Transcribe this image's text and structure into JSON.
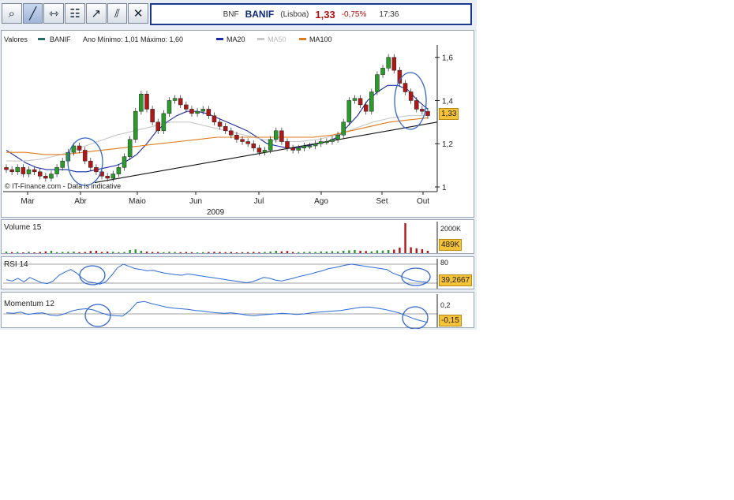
{
  "toolbar": {
    "tools": [
      "zoom-in",
      "draw-line",
      "horizontal-line",
      "indicators",
      "trend-line",
      "parallel-lines",
      "delete"
    ]
  },
  "quote": {
    "symbol": "BNF",
    "name": "BANIF",
    "market": "(Lisboa)",
    "price": "1,33",
    "change": "-0,75%",
    "time": "17:36"
  },
  "legend": {
    "values": "Valores",
    "series": "BANIF",
    "range": "Ano Mínimo: 1,01 Máximo: 1,60",
    "ma20": "MA20",
    "ma50": "MA50",
    "ma100": "MA100"
  },
  "colors": {
    "up": "#2a9a2a",
    "down": "#b01818",
    "ma20": "#1a2aa8",
    "ma50": "#c8c8c8",
    "ma100": "#e07a1a",
    "indicator": "#2a6ad8",
    "circle": "#3366cc",
    "tag": "#f6c23a"
  },
  "watermark": "© IT-Finance.com - Data is indicative",
  "year_label": "2009",
  "current_tag": "1,33",
  "volume": {
    "label": "Volume 15",
    "tick": "2000K",
    "tag": "489K"
  },
  "rsi": {
    "label": "RSI 14",
    "tick": "80",
    "tag": "39,2667"
  },
  "momentum": {
    "label": "Momentum 12",
    "tick": "0,2",
    "tag": "-0,15"
  },
  "chart_data": {
    "type": "candlestick",
    "title": "",
    "ylabel": "",
    "ylim": [
      1.0,
      1.65
    ],
    "y_ticks": [
      "1,6",
      "1,4",
      "1,2",
      "1"
    ],
    "x_ticks": [
      "Mar",
      "Abr",
      "Maio",
      "Jun",
      "Jul",
      "Ago",
      "Set",
      "Out"
    ],
    "series": [
      {
        "name": "BANIF",
        "close": [
          1.08,
          1.07,
          1.09,
          1.06,
          1.08,
          1.07,
          1.05,
          1.04,
          1.06,
          1.09,
          1.12,
          1.16,
          1.19,
          1.17,
          1.12,
          1.09,
          1.07,
          1.05,
          1.04,
          1.06,
          1.09,
          1.14,
          1.22,
          1.35,
          1.43,
          1.36,
          1.3,
          1.26,
          1.34,
          1.4,
          1.41,
          1.38,
          1.36,
          1.34,
          1.35,
          1.36,
          1.33,
          1.3,
          1.28,
          1.26,
          1.24,
          1.22,
          1.21,
          1.2,
          1.18,
          1.16,
          1.17,
          1.22,
          1.26,
          1.21,
          1.18,
          1.17,
          1.18,
          1.19,
          1.19,
          1.2,
          1.21,
          1.21,
          1.22,
          1.24,
          1.3,
          1.4,
          1.41,
          1.38,
          1.35,
          1.44,
          1.52,
          1.55,
          1.6,
          1.54,
          1.48,
          1.44,
          1.4,
          1.36,
          1.35,
          1.33
        ]
      },
      {
        "name": "MA20",
        "values": [
          1.17,
          1.14,
          1.11,
          1.09,
          1.08,
          1.08,
          1.08,
          1.07,
          1.07,
          1.08,
          1.09,
          1.1,
          1.12,
          1.15,
          1.2,
          1.26,
          1.3,
          1.33,
          1.35,
          1.35,
          1.34,
          1.32,
          1.3,
          1.28,
          1.26,
          1.23,
          1.2,
          1.19,
          1.18,
          1.18,
          1.19,
          1.2,
          1.21,
          1.23,
          1.28,
          1.33,
          1.4,
          1.44,
          1.47,
          1.47,
          1.45,
          1.4,
          1.36
        ]
      },
      {
        "name": "MA50",
        "values": [
          1.12,
          1.12,
          1.13,
          1.15,
          1.18,
          1.21,
          1.24,
          1.26,
          1.28,
          1.3,
          1.3,
          1.28,
          1.26,
          1.24,
          1.22,
          1.21,
          1.21,
          1.22,
          1.24,
          1.27,
          1.3,
          1.32,
          1.33,
          1.33
        ]
      },
      {
        "name": "MA100",
        "values": [
          1.16,
          1.16,
          1.15,
          1.15,
          1.16,
          1.17,
          1.18,
          1.19,
          1.2,
          1.21,
          1.22,
          1.23,
          1.23,
          1.23,
          1.23,
          1.23,
          1.23,
          1.24,
          1.26,
          1.28,
          1.3,
          1.31,
          1.32
        ]
      }
    ],
    "trend_line": [
      1.02,
      1.3
    ],
    "volume": [
      40,
      25,
      30,
      20,
      35,
      20,
      30,
      45,
      60,
      25,
      30,
      35,
      40,
      25,
      30,
      55,
      60,
      30,
      40,
      35,
      25,
      30,
      80,
      95,
      60,
      40,
      30,
      30,
      25,
      35,
      30,
      25,
      30,
      25,
      20,
      25,
      30,
      35,
      30,
      25,
      30,
      20,
      25,
      25,
      30,
      25,
      30,
      40,
      60,
      45,
      55,
      30,
      25,
      30,
      35,
      30,
      45,
      40,
      50,
      40,
      60,
      70,
      80,
      60,
      55,
      45,
      70,
      65,
      80,
      90,
      140,
      2000,
      150,
      120,
      100,
      60
    ],
    "rsi": [
      45,
      42,
      48,
      40,
      50,
      44,
      38,
      36,
      42,
      55,
      62,
      68,
      60,
      48,
      40,
      38,
      35,
      40,
      55,
      72,
      80,
      75,
      70,
      68,
      65,
      66,
      63,
      60,
      58,
      56,
      55,
      58,
      56,
      54,
      52,
      50,
      48,
      46,
      44,
      42,
      40,
      38,
      40,
      45,
      50,
      48,
      44,
      42,
      45,
      48,
      52,
      55,
      58,
      62,
      65,
      70,
      72,
      75,
      78,
      80,
      78,
      76,
      74,
      72,
      70,
      68,
      60,
      55,
      50,
      45,
      42,
      40,
      39
    ],
    "momentum": [
      0.02,
      0.01,
      0.03,
      -0.01,
      0.01,
      0.02,
      -0.02,
      -0.03,
      0.0,
      0.05,
      0.08,
      0.09,
      0.07,
      0.02,
      -0.02,
      -0.03,
      -0.04,
      0.06,
      0.2,
      0.22,
      0.18,
      0.15,
      0.12,
      0.1,
      0.09,
      0.08,
      0.06,
      0.05,
      0.03,
      0.02,
      0.01,
      0.02,
      0.0,
      -0.02,
      -0.03,
      -0.02,
      -0.01,
      0.0,
      0.01,
      0.0,
      -0.01,
      0.0,
      0.02,
      0.03,
      0.04,
      0.05,
      0.06,
      0.08,
      0.1,
      0.12,
      0.12,
      0.1,
      0.08,
      0.05,
      0.02,
      -0.03,
      -0.08,
      -0.12,
      -0.15
    ]
  }
}
